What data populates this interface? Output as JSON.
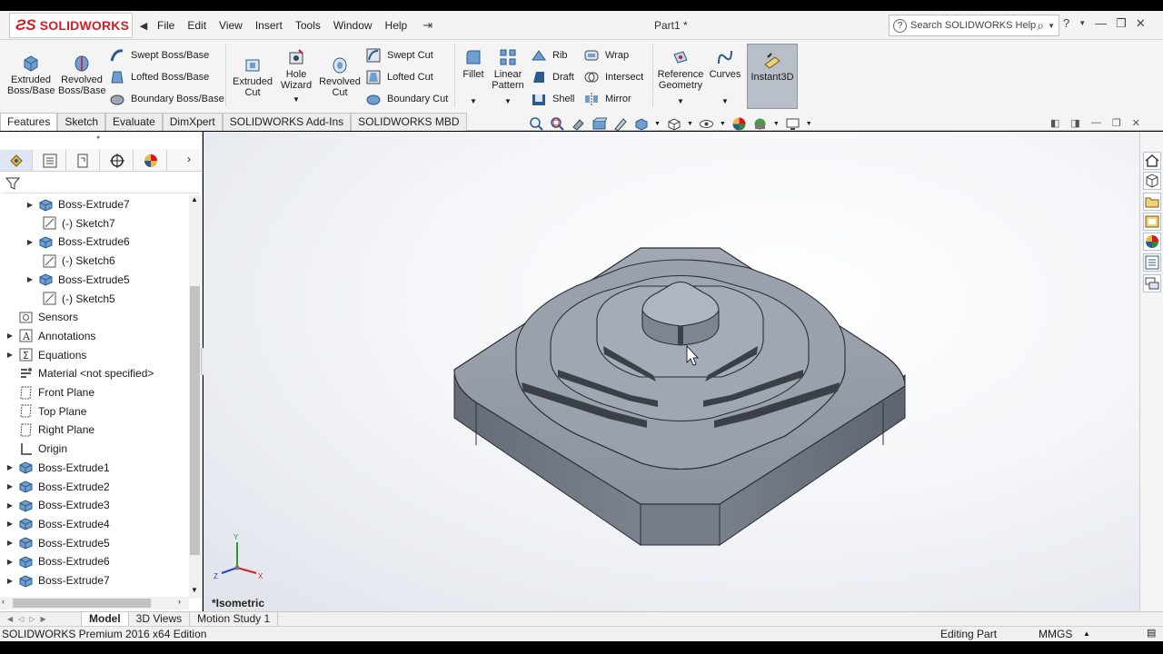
{
  "app": {
    "brand": "SOLIDWORKS",
    "document_title": "Part1 *",
    "menu": [
      "File",
      "Edit",
      "View",
      "Insert",
      "Tools",
      "Window",
      "Help"
    ],
    "help_search_placeholder": "Search SOLIDWORKS Help"
  },
  "ribbon": {
    "extruded_boss": [
      "Extruded",
      "Boss/Base"
    ],
    "revolved_boss": [
      "Revolved",
      "Boss/Base"
    ],
    "swept_boss": "Swept Boss/Base",
    "lofted_boss": "Lofted Boss/Base",
    "boundary_boss": "Boundary Boss/Base",
    "extruded_cut": [
      "Extruded",
      "Cut"
    ],
    "hole_wizard": [
      "Hole",
      "Wizard"
    ],
    "revolved_cut": [
      "Revolved",
      "Cut"
    ],
    "swept_cut": "Swept Cut",
    "lofted_cut": "Lofted Cut",
    "boundary_cut": "Boundary Cut",
    "fillet": "Fillet",
    "linear_pattern": [
      "Linear",
      "Pattern"
    ],
    "rib": "Rib",
    "draft": "Draft",
    "shell": "Shell",
    "wrap": "Wrap",
    "intersect": "Intersect",
    "mirror": "Mirror",
    "reference_geometry": [
      "Reference",
      "Geometry"
    ],
    "curves": "Curves",
    "instant3d": "Instant3D"
  },
  "tabs": [
    "Features",
    "Sketch",
    "Evaluate",
    "DimXpert",
    "SOLIDWORKS Add-Ins",
    "SOLIDWORKS MBD"
  ],
  "tree": [
    {
      "label": "Boss-Extrude7",
      "icon": "boss-extrude-icon",
      "indent": 1,
      "expandable": true
    },
    {
      "label": "(-) Sketch7",
      "icon": "sketch-icon",
      "indent": 2,
      "expandable": false
    },
    {
      "label": "Boss-Extrude6",
      "icon": "boss-extrude-icon",
      "indent": 1,
      "expandable": true
    },
    {
      "label": "(-) Sketch6",
      "icon": "sketch-icon",
      "indent": 2,
      "expandable": false
    },
    {
      "label": "Boss-Extrude5",
      "icon": "boss-extrude-icon",
      "indent": 1,
      "expandable": true
    },
    {
      "label": "(-) Sketch5",
      "icon": "sketch-icon",
      "indent": 2,
      "expandable": false
    },
    {
      "label": "Sensors",
      "icon": "sensors-icon",
      "indent": 0,
      "expandable": false
    },
    {
      "label": "Annotations",
      "icon": "annotations-icon",
      "indent": 0,
      "expandable": true
    },
    {
      "label": "Equations",
      "icon": "equations-icon",
      "indent": 0,
      "expandable": true
    },
    {
      "label": "Material <not specified>",
      "icon": "material-icon",
      "indent": 0,
      "expandable": false
    },
    {
      "label": "Front Plane",
      "icon": "plane-icon",
      "indent": 0,
      "expandable": false
    },
    {
      "label": "Top Plane",
      "icon": "plane-icon",
      "indent": 0,
      "expandable": false
    },
    {
      "label": "Right Plane",
      "icon": "plane-icon",
      "indent": 0,
      "expandable": false
    },
    {
      "label": "Origin",
      "icon": "origin-icon",
      "indent": 0,
      "expandable": false
    },
    {
      "label": "Boss-Extrude1",
      "icon": "boss-extrude-icon",
      "indent": 0,
      "expandable": true
    },
    {
      "label": "Boss-Extrude2",
      "icon": "boss-extrude-icon",
      "indent": 0,
      "expandable": true
    },
    {
      "label": "Boss-Extrude3",
      "icon": "boss-extrude-icon",
      "indent": 0,
      "expandable": true
    },
    {
      "label": "Boss-Extrude4",
      "icon": "boss-extrude-icon",
      "indent": 0,
      "expandable": true
    },
    {
      "label": "Boss-Extrude5",
      "icon": "boss-extrude-icon",
      "indent": 0,
      "expandable": true
    },
    {
      "label": "Boss-Extrude6",
      "icon": "boss-extrude-icon",
      "indent": 0,
      "expandable": true
    },
    {
      "label": "Boss-Extrude7",
      "icon": "boss-extrude-icon",
      "indent": 0,
      "expandable": true
    }
  ],
  "viewport": {
    "view_label": "*Isometric",
    "triad_labels": {
      "x": "X",
      "y": "Y",
      "z": "Z"
    },
    "model_color": "#8b919c"
  },
  "bottom_tabs": [
    "Model",
    "3D Views",
    "Motion Study 1"
  ],
  "status": {
    "edition": "SOLIDWORKS Premium 2016 x64 Edition",
    "mode": "Editing Part",
    "units": "MMGS"
  },
  "colors": {
    "brand_red": "#d11f26",
    "active_blue": "#dde6f2"
  }
}
